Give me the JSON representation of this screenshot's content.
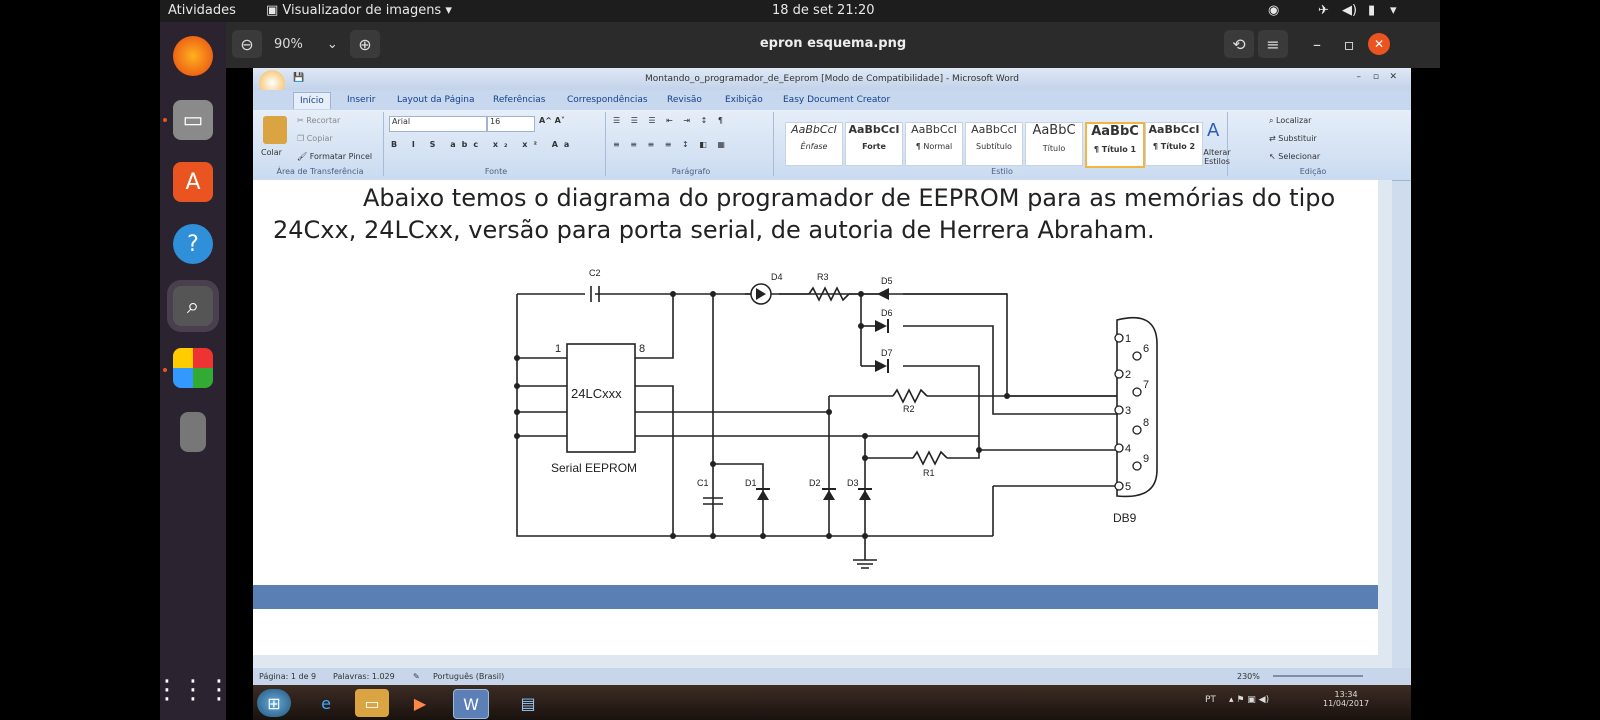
{
  "topbar": {
    "activities": "Atividades",
    "app_menu": "Visualizador de imagens",
    "datetime": "18 de set  21:20"
  },
  "viewer": {
    "zoom": "90%",
    "title": "epron esquema.png"
  },
  "word": {
    "title": "Montando_o_programador_de_Eeprom [Modo de Compatibilidade] - Microsoft Word",
    "tabs": [
      "Início",
      "Inserir",
      "Layout da Página",
      "Referências",
      "Correspondências",
      "Revisão",
      "Exibição",
      "Easy Document Creator"
    ],
    "clipboard": {
      "paste": "Colar",
      "cut": "Recortar",
      "copy": "Copiar",
      "format_painter": "Formatar Pincel",
      "label": "Área de Transferência"
    },
    "font": {
      "name": "Arial",
      "size": "16",
      "label": "Fonte"
    },
    "paragraph_label": "Parágrafo",
    "styles": [
      {
        "sample": "AaBbCcI",
        "name": "Ênfase"
      },
      {
        "sample": "AaBbCcI",
        "name": "Forte"
      },
      {
        "sample": "AaBbCcI",
        "name": "¶ Normal"
      },
      {
        "sample": "AaBbCcI",
        "name": "Subtítulo"
      },
      {
        "sample": "AaBbC",
        "name": "Título"
      },
      {
        "sample": "AaBbC",
        "name": "¶ Título 1"
      },
      {
        "sample": "AaBbCcI",
        "name": "¶ Título 2"
      }
    ],
    "styles_label": "Estilo",
    "change_styles": "Alterar Estilos",
    "editing": {
      "find": "Localizar",
      "replace": "Substituir",
      "select": "Selecionar",
      "label": "Edição"
    },
    "doc": {
      "line1": "Abaixo temos o diagrama do programador de EEPROM para as memórias do tipo",
      "line2": "24Cxx, 24LCxx, versão para porta serial, de autoria de Herrera Abraham."
    },
    "status": {
      "page": "Página: 1 de 9",
      "words": "Palavras: 1.029",
      "language": "Português (Brasil)",
      "zoom": "230%"
    }
  },
  "schematic": {
    "chip": "24LCxxx",
    "chip_caption": "Serial EEPROM",
    "pin1": "1",
    "pin8": "8",
    "connector": "DB9",
    "labels": {
      "c1": "C1",
      "c2": "C2",
      "d1": "D1",
      "d2": "D2",
      "d3": "D3",
      "d4": "D4",
      "d5": "D5",
      "d6": "D6",
      "d7": "D7",
      "r1": "R1",
      "r2": "R2",
      "r3": "R3"
    },
    "pins": {
      "p1": "1",
      "p2": "2",
      "p3": "3",
      "p4": "4",
      "p5": "5",
      "p6": "6",
      "p7": "7",
      "p8": "8",
      "p9": "9"
    }
  },
  "taskbar": {
    "lang": "PT",
    "time": "13:34",
    "date": "11/04/2017"
  }
}
